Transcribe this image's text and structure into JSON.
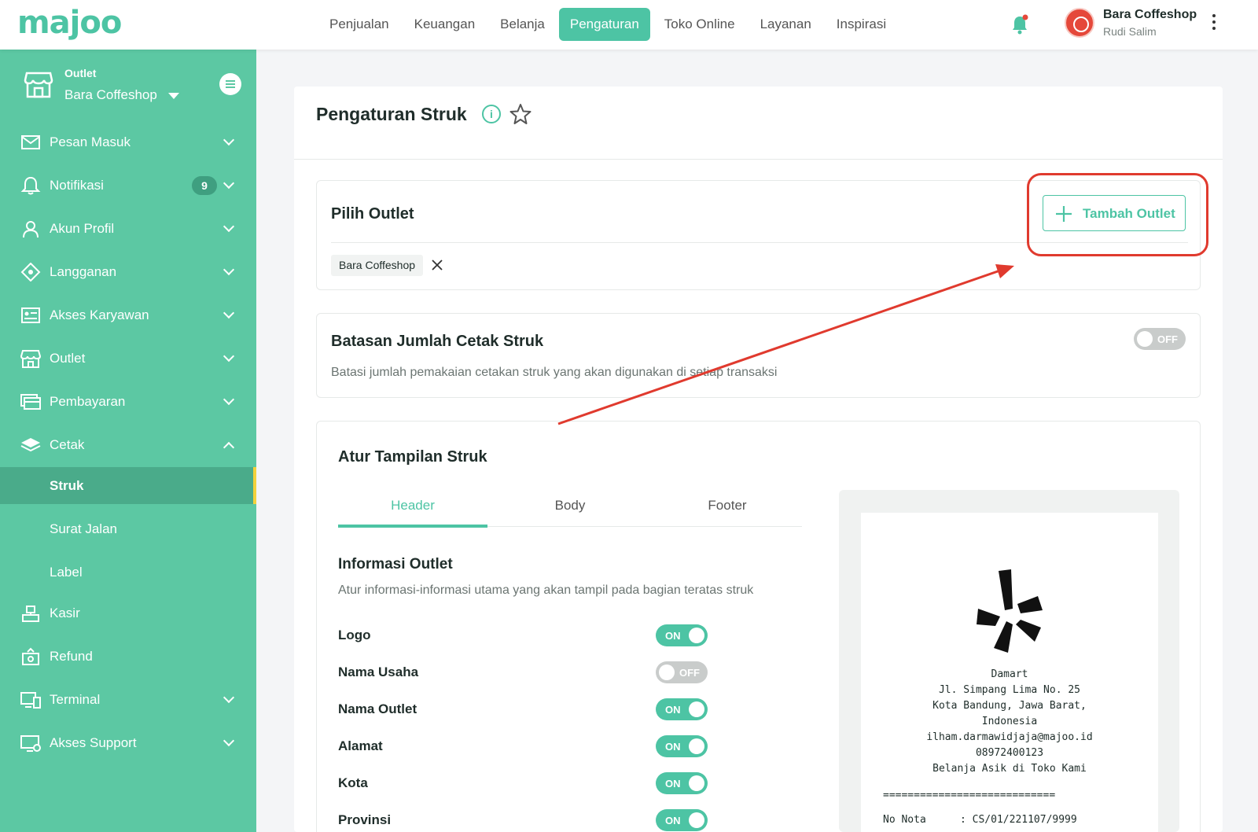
{
  "brand": {
    "logo_text": "majoo",
    "accent": "#4dc4a4",
    "sidebar_bg": "#5cc8a3"
  },
  "topnav": [
    {
      "label": "Penjualan",
      "active": false
    },
    {
      "label": "Keuangan",
      "active": false
    },
    {
      "label": "Belanja",
      "active": false
    },
    {
      "label": "Pengaturan",
      "active": true
    },
    {
      "label": "Toko Online",
      "active": false
    },
    {
      "label": "Layanan",
      "active": false
    },
    {
      "label": "Inspirasi",
      "active": false
    }
  ],
  "user": {
    "business": "Bara Coffeshop",
    "name": "Rudi Salim"
  },
  "sidebar": {
    "outlet_label": "Outlet",
    "outlet_name": "Bara Coffeshop",
    "items": [
      {
        "label": "Pesan Masuk",
        "icon": "mail-icon"
      },
      {
        "label": "Notifikasi",
        "icon": "bell-icon",
        "badge": "9"
      },
      {
        "label": "Akun Profil",
        "icon": "user-icon"
      },
      {
        "label": "Langganan",
        "icon": "tag-icon"
      },
      {
        "label": "Akses Karyawan",
        "icon": "id-card-icon"
      },
      {
        "label": "Outlet",
        "icon": "store-icon"
      },
      {
        "label": "Pembayaran",
        "icon": "card-icon"
      },
      {
        "label": "Cetak",
        "icon": "print-icon"
      },
      {
        "label": "Kasir",
        "icon": "cashier-icon"
      },
      {
        "label": "Refund",
        "icon": "refund-icon"
      },
      {
        "label": "Terminal",
        "icon": "terminal-icon"
      },
      {
        "label": "Akses Support",
        "icon": "support-icon"
      }
    ],
    "sub_items": [
      {
        "label": "Struk",
        "active": true
      },
      {
        "label": "Surat Jalan",
        "active": false
      },
      {
        "label": "Label",
        "active": false
      }
    ]
  },
  "page": {
    "title": "Pengaturan Struk"
  },
  "pilih_outlet": {
    "title": "Pilih Outlet",
    "add_button": "Tambah Outlet",
    "selected": "Bara Coffeshop"
  },
  "batasan": {
    "title": "Batasan Jumlah Cetak Struk",
    "desc": "Batasi jumlah pemakaian cetakan struk yang akan digunakan di setiap transaksi",
    "toggle": "OFF"
  },
  "atur": {
    "title": "Atur Tampilan Struk",
    "tabs": [
      "Header",
      "Body",
      "Footer"
    ],
    "active_tab": "Header",
    "section_title": "Informasi Outlet",
    "section_desc": "Atur informasi-informasi utama yang akan tampil pada bagian teratas struk",
    "fields": [
      {
        "label": "Logo",
        "state": "ON"
      },
      {
        "label": "Nama Usaha",
        "state": "OFF"
      },
      {
        "label": "Nama Outlet",
        "state": "ON"
      },
      {
        "label": "Alamat",
        "state": "ON"
      },
      {
        "label": "Kota",
        "state": "ON"
      },
      {
        "label": "Provinsi",
        "state": "ON"
      }
    ]
  },
  "receipt": {
    "lines": [
      "Damart",
      "Jl. Simpang Lima No. 25",
      "Kota Bandung, Jawa Barat,",
      "Indonesia",
      "ilham.darmawidjaja@majoo.id",
      "08972400123",
      "Belanja Asik di Toko Kami"
    ],
    "divider": "============================",
    "nota_label": "No Nota",
    "nota_value": ": CS/01/221107/9999"
  }
}
